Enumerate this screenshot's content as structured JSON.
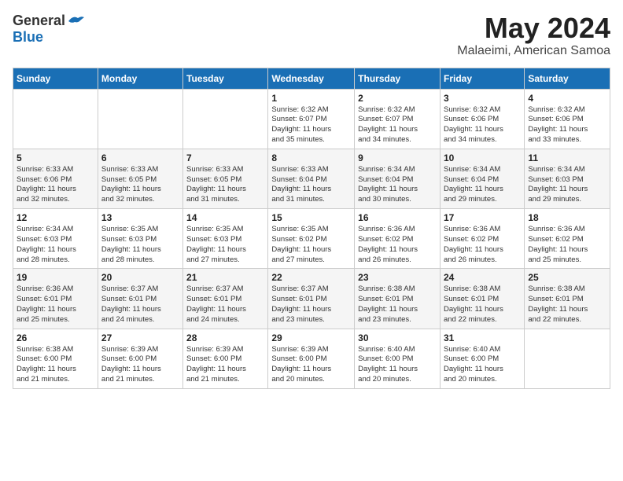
{
  "header": {
    "logo_general": "General",
    "logo_blue": "Blue",
    "month_title": "May 2024",
    "location": "Malaeimi, American Samoa"
  },
  "weekdays": [
    "Sunday",
    "Monday",
    "Tuesday",
    "Wednesday",
    "Thursday",
    "Friday",
    "Saturday"
  ],
  "weeks": [
    [
      {
        "day": "",
        "info": ""
      },
      {
        "day": "",
        "info": ""
      },
      {
        "day": "",
        "info": ""
      },
      {
        "day": "1",
        "info": "Sunrise: 6:32 AM\nSunset: 6:07 PM\nDaylight: 11 hours\nand 35 minutes."
      },
      {
        "day": "2",
        "info": "Sunrise: 6:32 AM\nSunset: 6:07 PM\nDaylight: 11 hours\nand 34 minutes."
      },
      {
        "day": "3",
        "info": "Sunrise: 6:32 AM\nSunset: 6:06 PM\nDaylight: 11 hours\nand 34 minutes."
      },
      {
        "day": "4",
        "info": "Sunrise: 6:32 AM\nSunset: 6:06 PM\nDaylight: 11 hours\nand 33 minutes."
      }
    ],
    [
      {
        "day": "5",
        "info": "Sunrise: 6:33 AM\nSunset: 6:06 PM\nDaylight: 11 hours\nand 32 minutes."
      },
      {
        "day": "6",
        "info": "Sunrise: 6:33 AM\nSunset: 6:05 PM\nDaylight: 11 hours\nand 32 minutes."
      },
      {
        "day": "7",
        "info": "Sunrise: 6:33 AM\nSunset: 6:05 PM\nDaylight: 11 hours\nand 31 minutes."
      },
      {
        "day": "8",
        "info": "Sunrise: 6:33 AM\nSunset: 6:04 PM\nDaylight: 11 hours\nand 31 minutes."
      },
      {
        "day": "9",
        "info": "Sunrise: 6:34 AM\nSunset: 6:04 PM\nDaylight: 11 hours\nand 30 minutes."
      },
      {
        "day": "10",
        "info": "Sunrise: 6:34 AM\nSunset: 6:04 PM\nDaylight: 11 hours\nand 29 minutes."
      },
      {
        "day": "11",
        "info": "Sunrise: 6:34 AM\nSunset: 6:03 PM\nDaylight: 11 hours\nand 29 minutes."
      }
    ],
    [
      {
        "day": "12",
        "info": "Sunrise: 6:34 AM\nSunset: 6:03 PM\nDaylight: 11 hours\nand 28 minutes."
      },
      {
        "day": "13",
        "info": "Sunrise: 6:35 AM\nSunset: 6:03 PM\nDaylight: 11 hours\nand 28 minutes."
      },
      {
        "day": "14",
        "info": "Sunrise: 6:35 AM\nSunset: 6:03 PM\nDaylight: 11 hours\nand 27 minutes."
      },
      {
        "day": "15",
        "info": "Sunrise: 6:35 AM\nSunset: 6:02 PM\nDaylight: 11 hours\nand 27 minutes."
      },
      {
        "day": "16",
        "info": "Sunrise: 6:36 AM\nSunset: 6:02 PM\nDaylight: 11 hours\nand 26 minutes."
      },
      {
        "day": "17",
        "info": "Sunrise: 6:36 AM\nSunset: 6:02 PM\nDaylight: 11 hours\nand 26 minutes."
      },
      {
        "day": "18",
        "info": "Sunrise: 6:36 AM\nSunset: 6:02 PM\nDaylight: 11 hours\nand 25 minutes."
      }
    ],
    [
      {
        "day": "19",
        "info": "Sunrise: 6:36 AM\nSunset: 6:01 PM\nDaylight: 11 hours\nand 25 minutes."
      },
      {
        "day": "20",
        "info": "Sunrise: 6:37 AM\nSunset: 6:01 PM\nDaylight: 11 hours\nand 24 minutes."
      },
      {
        "day": "21",
        "info": "Sunrise: 6:37 AM\nSunset: 6:01 PM\nDaylight: 11 hours\nand 24 minutes."
      },
      {
        "day": "22",
        "info": "Sunrise: 6:37 AM\nSunset: 6:01 PM\nDaylight: 11 hours\nand 23 minutes."
      },
      {
        "day": "23",
        "info": "Sunrise: 6:38 AM\nSunset: 6:01 PM\nDaylight: 11 hours\nand 23 minutes."
      },
      {
        "day": "24",
        "info": "Sunrise: 6:38 AM\nSunset: 6:01 PM\nDaylight: 11 hours\nand 22 minutes."
      },
      {
        "day": "25",
        "info": "Sunrise: 6:38 AM\nSunset: 6:01 PM\nDaylight: 11 hours\nand 22 minutes."
      }
    ],
    [
      {
        "day": "26",
        "info": "Sunrise: 6:38 AM\nSunset: 6:00 PM\nDaylight: 11 hours\nand 21 minutes."
      },
      {
        "day": "27",
        "info": "Sunrise: 6:39 AM\nSunset: 6:00 PM\nDaylight: 11 hours\nand 21 minutes."
      },
      {
        "day": "28",
        "info": "Sunrise: 6:39 AM\nSunset: 6:00 PM\nDaylight: 11 hours\nand 21 minutes."
      },
      {
        "day": "29",
        "info": "Sunrise: 6:39 AM\nSunset: 6:00 PM\nDaylight: 11 hours\nand 20 minutes."
      },
      {
        "day": "30",
        "info": "Sunrise: 6:40 AM\nSunset: 6:00 PM\nDaylight: 11 hours\nand 20 minutes."
      },
      {
        "day": "31",
        "info": "Sunrise: 6:40 AM\nSunset: 6:00 PM\nDaylight: 11 hours\nand 20 minutes."
      },
      {
        "day": "",
        "info": ""
      }
    ]
  ]
}
